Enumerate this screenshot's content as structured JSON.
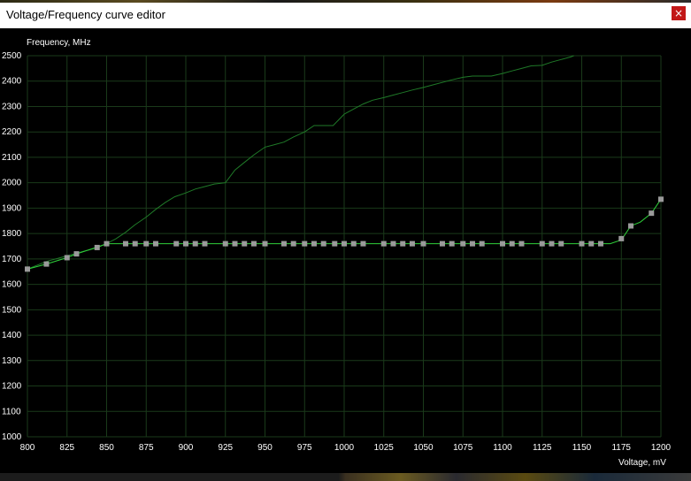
{
  "window": {
    "title": "Voltage/Frequency curve editor",
    "close_label": "×"
  },
  "chart_data": {
    "type": "line",
    "ylabel": "Frequency, MHz",
    "xlabel": "Voltage, mV",
    "xlim": [
      800,
      1200
    ],
    "ylim": [
      1000,
      2500
    ],
    "x_ticks": [
      800,
      825,
      850,
      875,
      900,
      925,
      950,
      975,
      1000,
      1025,
      1050,
      1075,
      1100,
      1125,
      1150,
      1175,
      1200
    ],
    "y_ticks": [
      1000,
      1100,
      1200,
      1300,
      1400,
      1500,
      1600,
      1700,
      1800,
      1900,
      2000,
      2100,
      2200,
      2300,
      2400,
      2500
    ],
    "grid": true,
    "colors": {
      "curve": "#2fd13a",
      "upper_curve": "#1f7a28",
      "grid": "#1a3a1a",
      "point": "#9a9a9a",
      "text": "#ffffff"
    },
    "series": [
      {
        "role": "upper",
        "x": [
          800,
          812,
          825,
          838,
          850,
          856,
          862,
          868,
          875,
          881,
          887,
          893,
          900,
          906,
          912,
          918,
          925,
          931,
          937,
          943,
          950,
          956,
          962,
          968,
          975,
          981,
          987,
          993,
          1000,
          1006,
          1012,
          1018,
          1025,
          1031,
          1037,
          1043,
          1050,
          1056,
          1062,
          1068,
          1075,
          1081,
          1087,
          1093,
          1100,
          1106,
          1112,
          1118,
          1125,
          1131,
          1137,
          1143,
          1145
        ],
        "y": [
          1660,
          1690,
          1712,
          1735,
          1760,
          1780,
          1805,
          1835,
          1865,
          1895,
          1922,
          1945,
          1960,
          1975,
          1985,
          1995,
          2000,
          2050,
          2080,
          2110,
          2140,
          2150,
          2160,
          2180,
          2200,
          2225,
          2225,
          2225,
          2270,
          2290,
          2310,
          2325,
          2335,
          2345,
          2355,
          2365,
          2375,
          2385,
          2395,
          2405,
          2415,
          2420,
          2420,
          2420,
          2430,
          2440,
          2450,
          2460,
          2462,
          2475,
          2485,
          2495,
          2500
        ]
      },
      {
        "role": "curve",
        "x": [
          800,
          812,
          825,
          831,
          837,
          844,
          850,
          862,
          868,
          875,
          881,
          894,
          900,
          906,
          912,
          925,
          931,
          937,
          943,
          950,
          962,
          968,
          975,
          981,
          987,
          994,
          1000,
          1006,
          1012,
          1025,
          1031,
          1037,
          1043,
          1050,
          1062,
          1068,
          1075,
          1081,
          1087,
          1100,
          1106,
          1112,
          1125,
          1131,
          1137,
          1150,
          1156,
          1162,
          1168,
          1175,
          1181,
          1187,
          1194,
          1200
        ],
        "y": [
          1660,
          1680,
          1705,
          1720,
          1732,
          1745,
          1760,
          1760,
          1760,
          1760,
          1760,
          1760,
          1760,
          1760,
          1760,
          1760,
          1760,
          1760,
          1760,
          1760,
          1760,
          1760,
          1760,
          1760,
          1760,
          1760,
          1760,
          1760,
          1760,
          1760,
          1760,
          1760,
          1760,
          1760,
          1760,
          1760,
          1760,
          1760,
          1760,
          1760,
          1760,
          1760,
          1760,
          1760,
          1760,
          1760,
          1760,
          1760,
          1760,
          1775,
          1830,
          1845,
          1880,
          1935
        ],
        "markers": [
          [
            800,
            1660
          ],
          [
            812,
            1680
          ],
          [
            825,
            1705
          ],
          [
            831,
            1720
          ],
          [
            844,
            1745
          ],
          [
            850,
            1760
          ],
          [
            862,
            1760
          ],
          [
            868,
            1760
          ],
          [
            875,
            1760
          ],
          [
            881,
            1760
          ],
          [
            894,
            1760
          ],
          [
            900,
            1760
          ],
          [
            906,
            1760
          ],
          [
            912,
            1760
          ],
          [
            925,
            1760
          ],
          [
            931,
            1760
          ],
          [
            937,
            1760
          ],
          [
            943,
            1760
          ],
          [
            950,
            1760
          ],
          [
            962,
            1760
          ],
          [
            968,
            1760
          ],
          [
            975,
            1760
          ],
          [
            981,
            1760
          ],
          [
            987,
            1760
          ],
          [
            994,
            1760
          ],
          [
            1000,
            1760
          ],
          [
            1006,
            1760
          ],
          [
            1012,
            1760
          ],
          [
            1025,
            1760
          ],
          [
            1031,
            1760
          ],
          [
            1037,
            1760
          ],
          [
            1043,
            1760
          ],
          [
            1050,
            1760
          ],
          [
            1062,
            1760
          ],
          [
            1068,
            1760
          ],
          [
            1075,
            1760
          ],
          [
            1081,
            1760
          ],
          [
            1087,
            1760
          ],
          [
            1100,
            1760
          ],
          [
            1106,
            1760
          ],
          [
            1112,
            1760
          ],
          [
            1125,
            1760
          ],
          [
            1131,
            1760
          ],
          [
            1137,
            1760
          ],
          [
            1150,
            1760
          ],
          [
            1156,
            1760
          ],
          [
            1162,
            1760
          ],
          [
            1175,
            1780
          ],
          [
            1181,
            1830
          ],
          [
            1194,
            1880
          ],
          [
            1200,
            1935
          ]
        ]
      }
    ]
  }
}
